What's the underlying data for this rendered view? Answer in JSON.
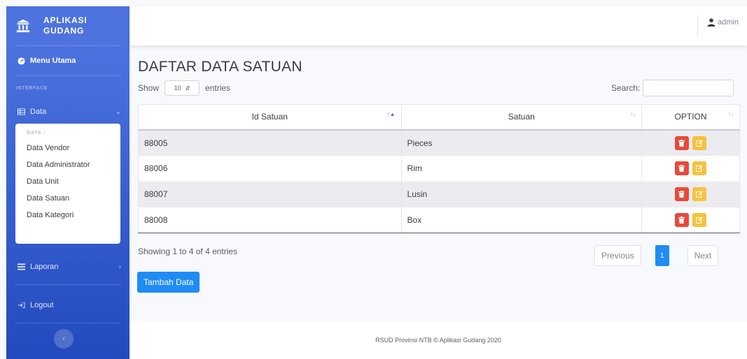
{
  "brand": {
    "line1": "APLIKASI",
    "line2": "GUDANG"
  },
  "sidebar": {
    "dashboard": "Menu Utama",
    "heading": "INTERFACE",
    "data_menu": "Data",
    "submenu_heading": "DATA :",
    "submenu_items": [
      "Data Vendor",
      "Data Administrator",
      "Data Unit",
      "Data Satuan",
      "Data Kategori"
    ],
    "report_menu": "Laporan",
    "logout": "Logout"
  },
  "topbar": {
    "user": "admin"
  },
  "main": {
    "title": "DAFTAR DATA SATUAN",
    "show_label": "Show",
    "entries_value": "10",
    "entries_label": "entries",
    "search_label": "Search:",
    "columns": [
      "Id Satuan",
      "Satuan",
      "OPTION"
    ],
    "rows": [
      {
        "id": "88005",
        "satuan": "Pieces"
      },
      {
        "id": "88006",
        "satuan": "Rim"
      },
      {
        "id": "88007",
        "satuan": "Lusin"
      },
      {
        "id": "88008",
        "satuan": "Box"
      }
    ],
    "info": "Showing 1 to 4 of 4 entries",
    "pagination": {
      "previous": "Previous",
      "current": "1",
      "next": "Next"
    },
    "add_button": "Tambah Data"
  },
  "footer": {
    "text": "RSUD Provinsi NTB © Aplikasi Gudang 2020"
  },
  "colors": {
    "primary": "#4e73df",
    "danger": "#e74a3b",
    "warning": "#f6c23e",
    "button_blue": "#1f8cf5"
  }
}
